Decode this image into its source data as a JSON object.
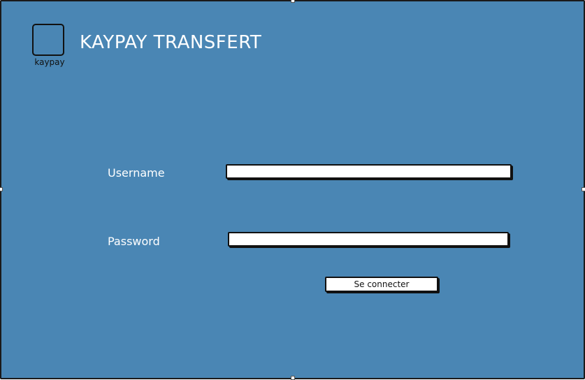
{
  "app": {
    "logo_text": "kaypay",
    "title": "KAYPAY TRANSFERT"
  },
  "login_form": {
    "username_label": "Username",
    "username_value": "",
    "password_label": "Password",
    "password_value": "",
    "submit_label": "Se connecter"
  },
  "colors": {
    "background": "#4a86b4",
    "border": "#111111",
    "text_light": "#ffffff"
  },
  "icons": {
    "logo": "logo-square-icon"
  }
}
